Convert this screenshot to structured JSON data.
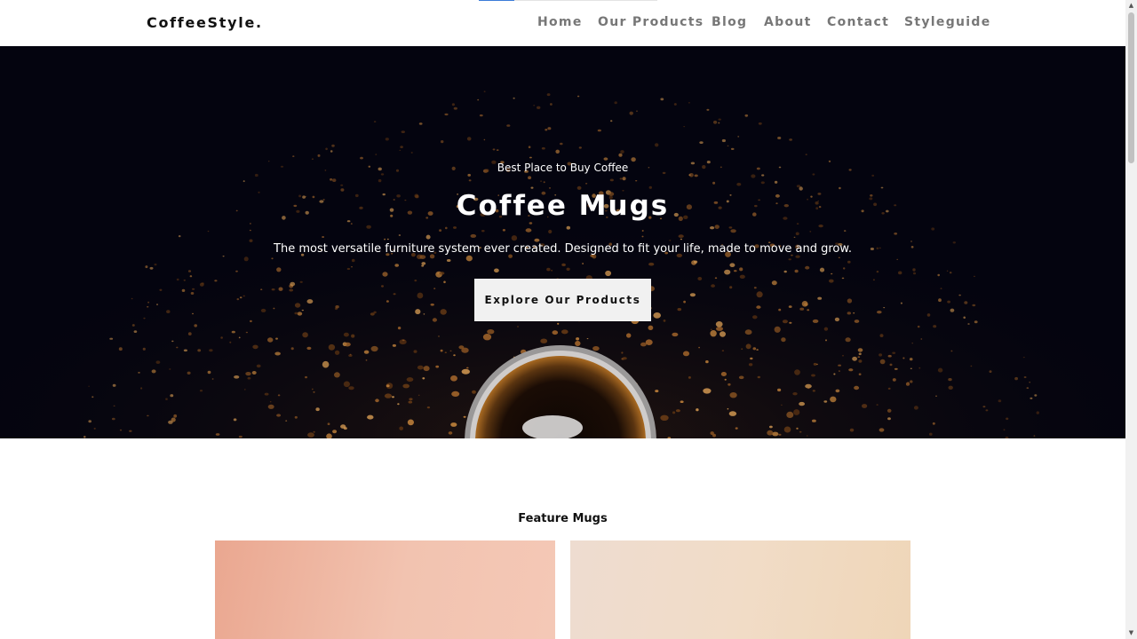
{
  "header": {
    "logo": "CoffeeStyle.",
    "nav": [
      "Home",
      "Our Products",
      "Blog",
      "About",
      "Contact",
      "Styleguide"
    ]
  },
  "hero": {
    "kicker": "Best Place to Buy Coffee",
    "title": "Coffee Mugs",
    "description": "The most versatile furniture system ever created. Designed to fit your life, made to move and grow.",
    "button": "Explore Our Products"
  },
  "featured": {
    "title": "Feature Mugs"
  },
  "colors": {
    "hero_background": "#04040f",
    "progress_accent": "#3b7bd8",
    "card_1": "#f2c3b0",
    "card_2": "#f1dcc7"
  },
  "icons": {
    "scroll_up": "triangle-up-icon",
    "scroll_down": "triangle-down-icon"
  }
}
